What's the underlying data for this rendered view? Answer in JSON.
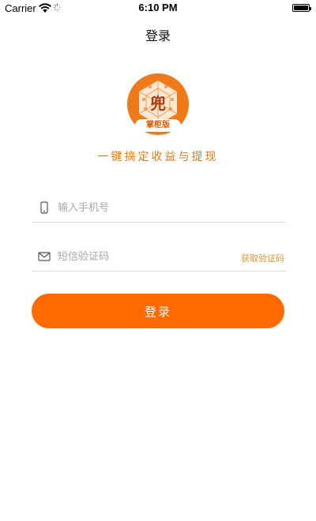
{
  "status_bar": {
    "carrier": "Carrier",
    "time": "6:10 PM"
  },
  "nav": {
    "title": "登录"
  },
  "logo": {
    "glyph": "兜",
    "badge": "掌柜版"
  },
  "slogan": "一键搞定收益与提现",
  "form": {
    "phone_placeholder": "输入手机号",
    "phone_value": "",
    "code_placeholder": "短信验证码",
    "code_value": "",
    "get_code_label": "获取验证码"
  },
  "login_button": "登录",
  "colors": {
    "accent": "#ff6a00",
    "slogan": "#e07b1a",
    "link": "#e0962a"
  },
  "icons": {
    "phone": "phone-icon",
    "message": "envelope-icon"
  }
}
